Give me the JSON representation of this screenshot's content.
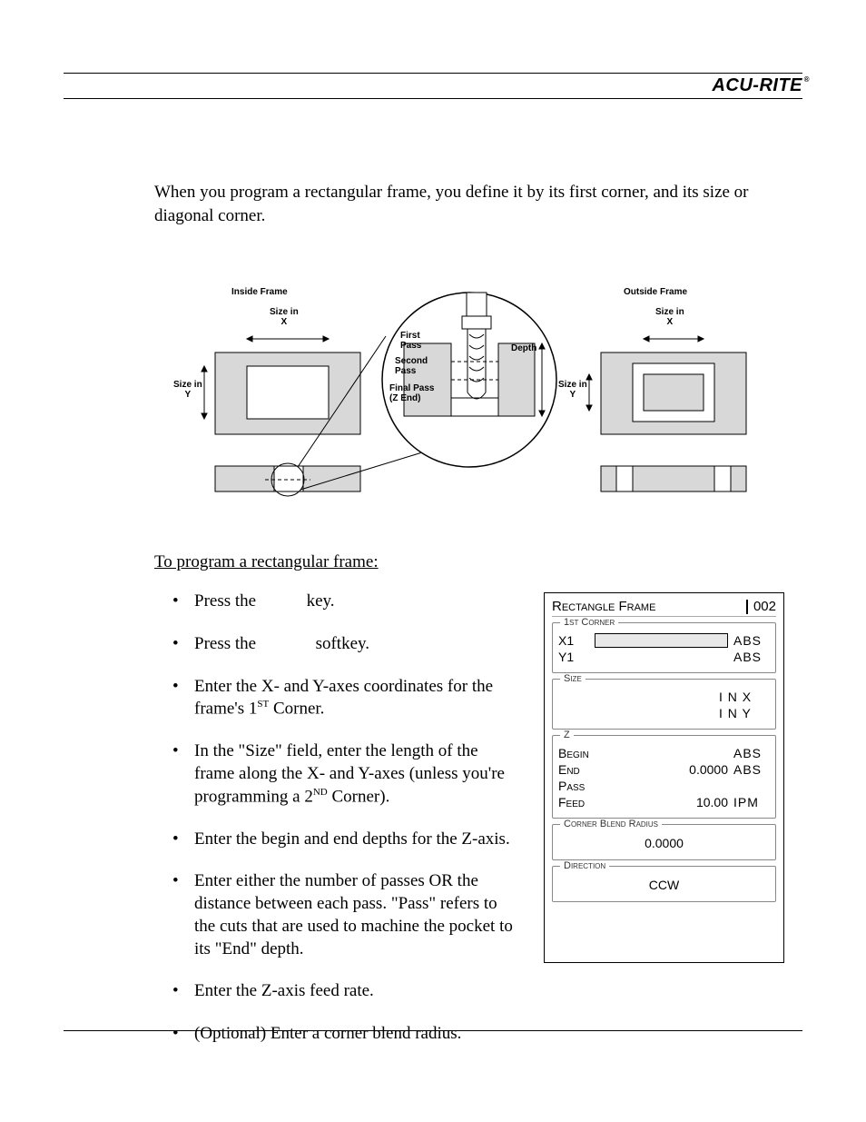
{
  "brand": "ACU-RITE",
  "intro": "When you program a rectangular frame, you define it by its first corner, and its size or diagonal corner.",
  "diagram": {
    "inside_frame": "Inside Frame",
    "outside_frame": "Outside Frame",
    "size_x": "Size in\nX",
    "size_y": "Size in\nY",
    "first_pass": "First\nPass",
    "second_pass": "Second\nPass",
    "final_pass": "Final Pass\n(Z End)",
    "depth": "Depth"
  },
  "section_heading": "To program a rectangular frame:",
  "steps": [
    {
      "pre": "Press the ",
      "mid": "",
      "post": " key."
    },
    {
      "pre": "Press the ",
      "mid": "",
      "post": " softkey."
    },
    {
      "text": "Enter the X- and Y-axes coordinates for the frame's 1",
      "sup": "ST",
      "tail": " Corner."
    },
    {
      "text": "In the \"Size\" field, enter the length of the frame along the X- and Y-axes (unless you're programming a 2",
      "sup": "ND",
      "tail": " Corner)."
    },
    {
      "plain": "Enter the begin and end depths for the Z-axis."
    },
    {
      "plain": "Enter either the number of passes OR the distance between each pass. \"Pass\" refers to the cuts that are used to machine the pocket to its \"End\" depth."
    },
    {
      "plain": "Enter the Z-axis feed rate."
    },
    {
      "plain": "(Optional) Enter a corner blend radius."
    }
  ],
  "screen": {
    "title": "Rectangle Frame",
    "number": "002",
    "groups": {
      "corner": {
        "label": "1st Corner",
        "rows": [
          {
            "axis": "X1",
            "input": true,
            "unit": "ABS"
          },
          {
            "axis": "Y1",
            "input": false,
            "unit": "ABS"
          }
        ]
      },
      "size": {
        "label": "Size",
        "rows": [
          {
            "axis": "",
            "val": "",
            "unit": "I N  X"
          },
          {
            "axis": "",
            "val": "",
            "unit": "I N  Y"
          }
        ]
      },
      "z": {
        "label": "Z",
        "rows": [
          {
            "axis": "Begin",
            "val": "",
            "unit": "ABS"
          },
          {
            "axis": "End",
            "val": "0.0000",
            "unit": "ABS"
          },
          {
            "axis": "Pass",
            "val": "",
            "unit": ""
          },
          {
            "axis": "Feed",
            "val": "10.00",
            "unit": "IPM"
          }
        ]
      },
      "radius": {
        "label": "Corner Blend Radius",
        "value": "0.0000"
      },
      "direction": {
        "label": "Direction",
        "value": "CCW"
      }
    }
  }
}
